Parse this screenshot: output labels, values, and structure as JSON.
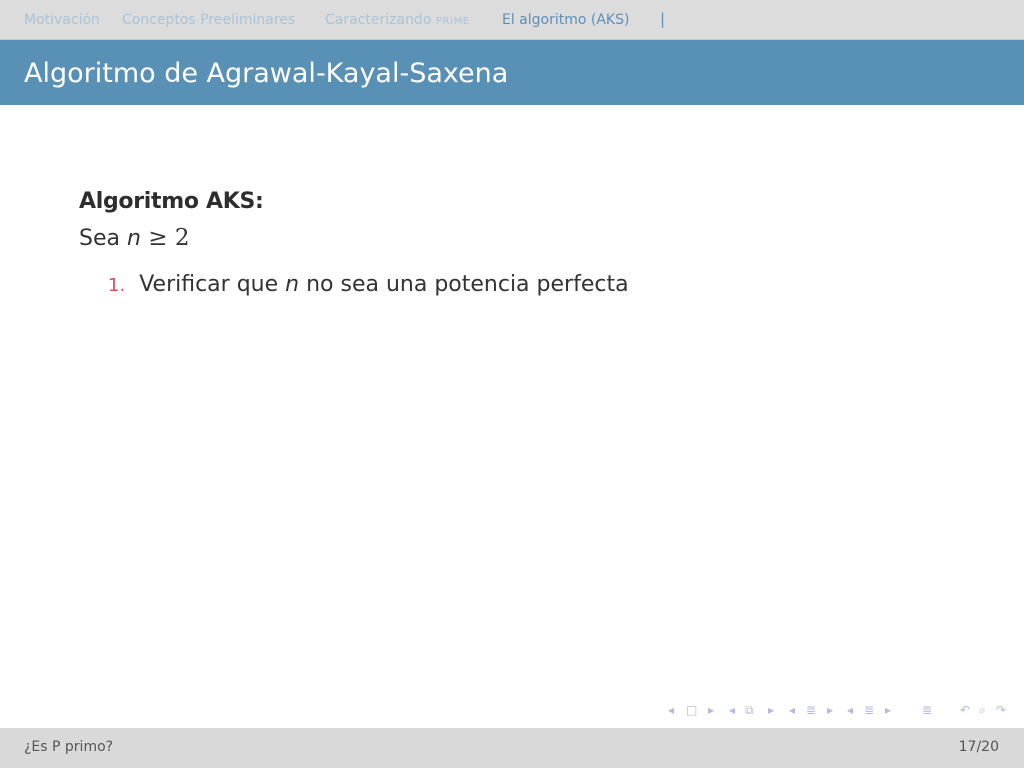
{
  "nav": {
    "sections": [
      {
        "label": "Motivación"
      },
      {
        "label": "Conceptos Preeliminares"
      },
      {
        "label_prefix": "Caracterizando ",
        "label_smallcaps": "PRIME"
      },
      {
        "label": "El algoritmo (AKS)",
        "active": true
      }
    ],
    "separator": "|"
  },
  "slide": {
    "title": "Algoritmo de Agrawal-Kayal-Saxena",
    "block_title": "Algoritmo AKS:",
    "intro": {
      "prefix": "Sea ",
      "variable": "n",
      "relation": " ≥ 2"
    },
    "items": [
      {
        "number": "1.",
        "text_before": "Verificar que ",
        "variable": "n",
        "text_after": " no sea una potencia perfecta"
      }
    ]
  },
  "nav_controls": [
    {
      "name": "frame-prev-icon",
      "glyph": "◂"
    },
    {
      "name": "frame-icon",
      "glyph": "□"
    },
    {
      "name": "frame-next-icon",
      "glyph": "▸"
    },
    {
      "name": "slide-prev-icon",
      "glyph": "◂"
    },
    {
      "name": "slide-icon",
      "glyph": "⧉"
    },
    {
      "name": "slide-next-icon",
      "glyph": "▸"
    },
    {
      "name": "subsection-prev-icon",
      "glyph": "◂"
    },
    {
      "name": "subsection-icon",
      "glyph": "≣"
    },
    {
      "name": "subsection-next-icon",
      "glyph": "▸"
    },
    {
      "name": "section-prev-icon",
      "glyph": "◂"
    },
    {
      "name": "section-icon",
      "glyph": "≣"
    },
    {
      "name": "section-next-icon",
      "glyph": "▸"
    },
    {
      "name": "document-icon",
      "glyph": "≣"
    },
    {
      "name": "undo-icon",
      "glyph": "↶"
    },
    {
      "name": "search-icon",
      "glyph": "⌕"
    },
    {
      "name": "redo-icon",
      "glyph": "↷"
    }
  ],
  "footer": {
    "title": "¿Es P primo?",
    "page": "17/20"
  },
  "colors": {
    "nav_bg": "#dcdcdc",
    "nav_link": "#a9c3d8",
    "nav_active": "#5b90b8",
    "title_band": "#5890b6",
    "enum_number": "#e34a5a",
    "footer_bg": "#d9d9d9",
    "nav_controls": "#b6b9dd"
  }
}
